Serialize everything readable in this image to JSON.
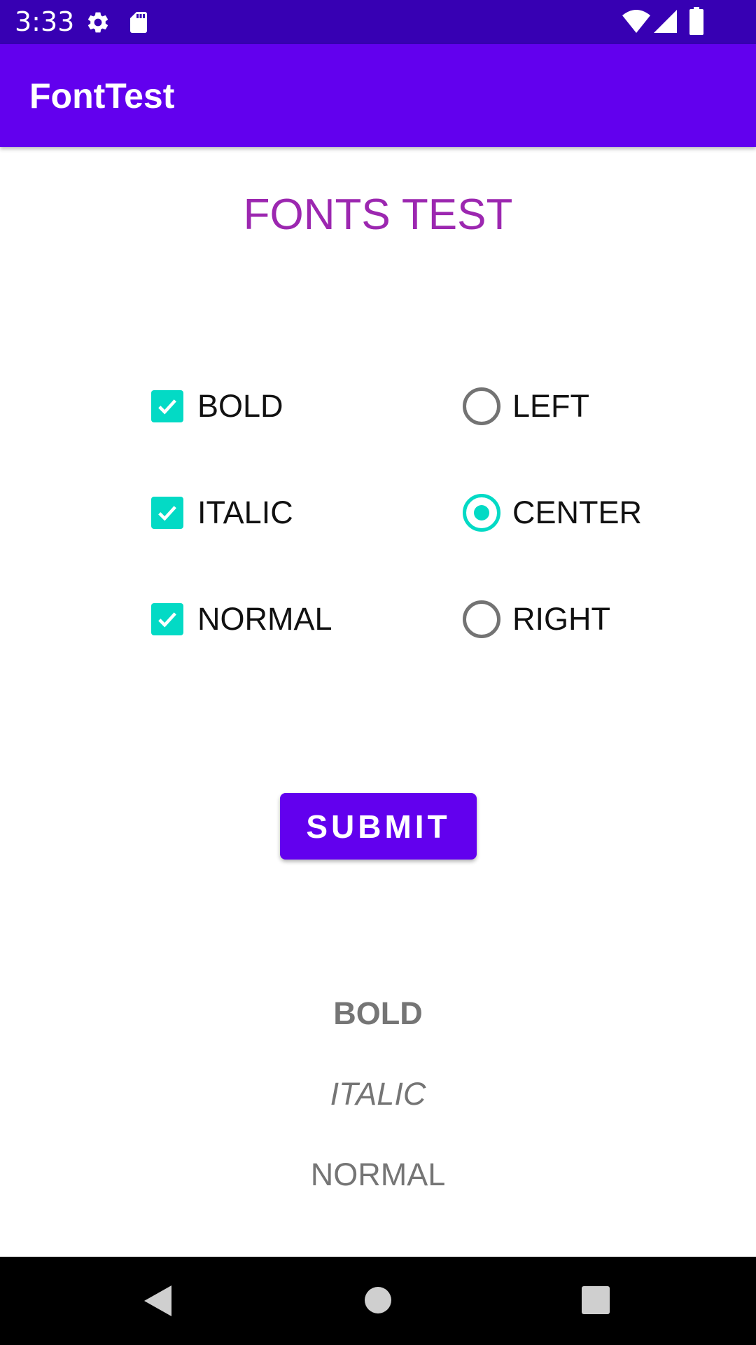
{
  "status_bar": {
    "time": "3:33",
    "left_icons": [
      "gear-icon",
      "sd-card-icon"
    ],
    "right_icons": [
      "wifi-icon",
      "signal-icon",
      "battery-icon"
    ]
  },
  "app_bar": {
    "title": "FontTest"
  },
  "main": {
    "heading": "FONTS TEST",
    "style_options": [
      {
        "label": "BOLD",
        "checked": true
      },
      {
        "label": "ITALIC",
        "checked": true
      },
      {
        "label": "NORMAL",
        "checked": true
      }
    ],
    "alignment_options": [
      {
        "label": "LEFT",
        "selected": false
      },
      {
        "label": "CENTER",
        "selected": true
      },
      {
        "label": "RIGHT",
        "selected": false
      }
    ],
    "submit_label": "SUBMIT",
    "preview": {
      "bold": "BOLD",
      "italic": "ITALIC",
      "normal": "NORMAL"
    }
  },
  "nav_bar": {
    "buttons": [
      "back-icon",
      "home-icon",
      "recents-icon"
    ]
  },
  "colors": {
    "status_bar": "#3700b3",
    "app_bar": "#6200ee",
    "heading": "#9c27b0",
    "accent": "#03dac5",
    "preview_text": "#757575"
  }
}
